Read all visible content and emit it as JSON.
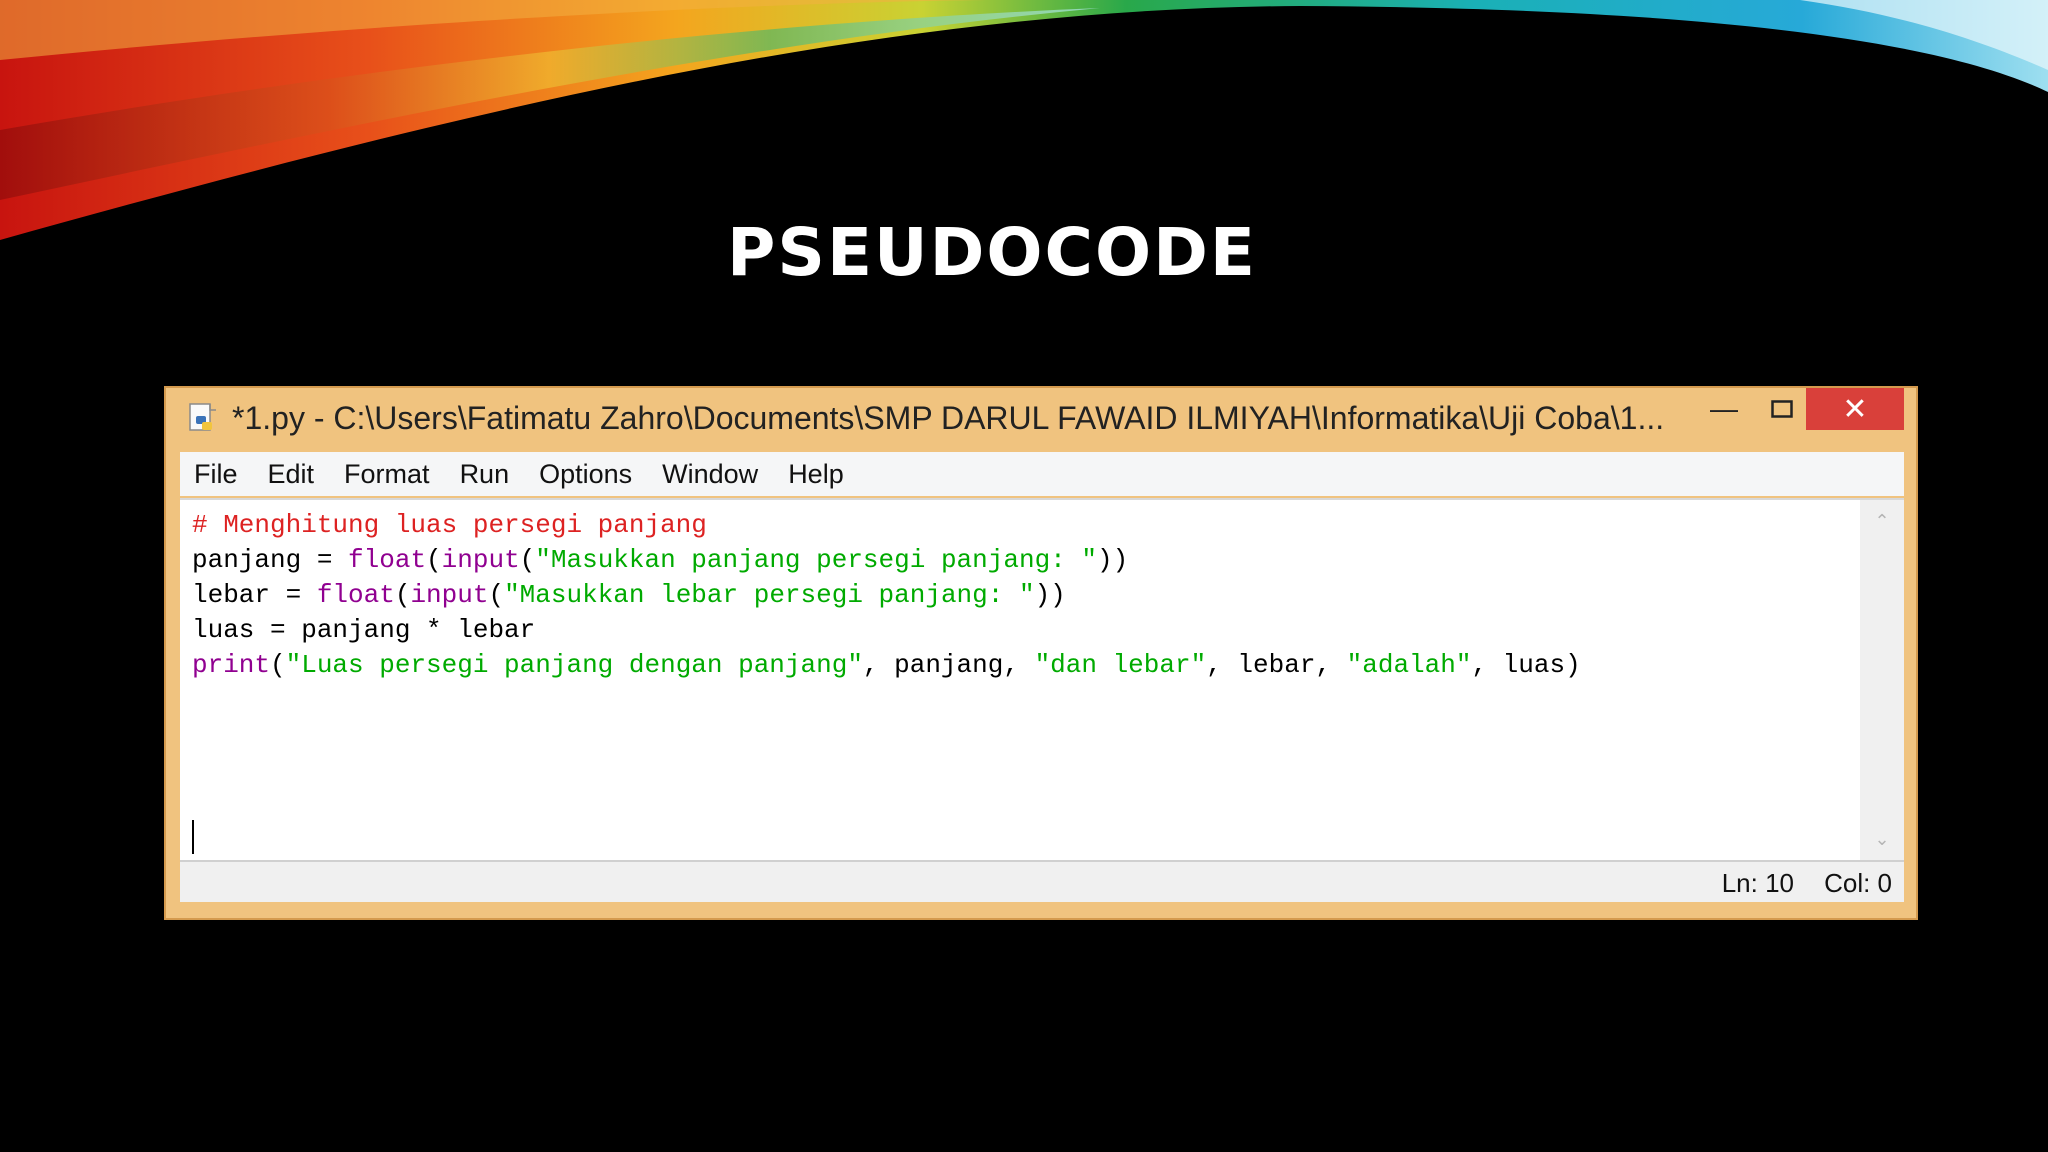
{
  "slide": {
    "title": "PSEUDOCODE"
  },
  "window": {
    "title": "*1.py - C:\\Users\\Fatimatu Zahro\\Documents\\SMP DARUL FAWAID ILMIYAH\\Informatika\\Uji Coba\\1...",
    "app_icon": "python-file-icon",
    "controls": {
      "minimize": "minimize-icon",
      "maximize": "maximize-icon",
      "close": "close-icon"
    }
  },
  "menu": {
    "items": [
      "File",
      "Edit",
      "Format",
      "Run",
      "Options",
      "Window",
      "Help"
    ]
  },
  "editor": {
    "lines": [
      [
        {
          "text": "# Menghitung luas persegi panjang",
          "kind": "comment"
        }
      ],
      [
        {
          "text": "panjang = ",
          "kind": "plain"
        },
        {
          "text": "float",
          "kind": "builtin"
        },
        {
          "text": "(",
          "kind": "plain"
        },
        {
          "text": "input",
          "kind": "builtin"
        },
        {
          "text": "(",
          "kind": "plain"
        },
        {
          "text": "\"Masukkan panjang persegi panjang: \"",
          "kind": "string"
        },
        {
          "text": "))",
          "kind": "plain"
        }
      ],
      [
        {
          "text": "lebar = ",
          "kind": "plain"
        },
        {
          "text": "float",
          "kind": "builtin"
        },
        {
          "text": "(",
          "kind": "plain"
        },
        {
          "text": "input",
          "kind": "builtin"
        },
        {
          "text": "(",
          "kind": "plain"
        },
        {
          "text": "\"Masukkan lebar persegi panjang: \"",
          "kind": "string"
        },
        {
          "text": "))",
          "kind": "plain"
        }
      ],
      [
        {
          "text": "luas = panjang * lebar",
          "kind": "plain"
        }
      ],
      [
        {
          "text": "print",
          "kind": "builtin"
        },
        {
          "text": "(",
          "kind": "plain"
        },
        {
          "text": "\"Luas persegi panjang dengan panjang\"",
          "kind": "string"
        },
        {
          "text": ", panjang, ",
          "kind": "plain"
        },
        {
          "text": "\"dan lebar\"",
          "kind": "string"
        },
        {
          "text": ", lebar, ",
          "kind": "plain"
        },
        {
          "text": "\"adalah\"",
          "kind": "string"
        },
        {
          "text": ", luas)",
          "kind": "plain"
        }
      ]
    ]
  },
  "status": {
    "line": "Ln: 10",
    "col": "Col: 0"
  },
  "colors": {
    "window_frame": "#f0c37f",
    "close_button": "#d9403a",
    "comment": "#dd2222",
    "builtin": "#900090",
    "string": "#00aa00"
  }
}
